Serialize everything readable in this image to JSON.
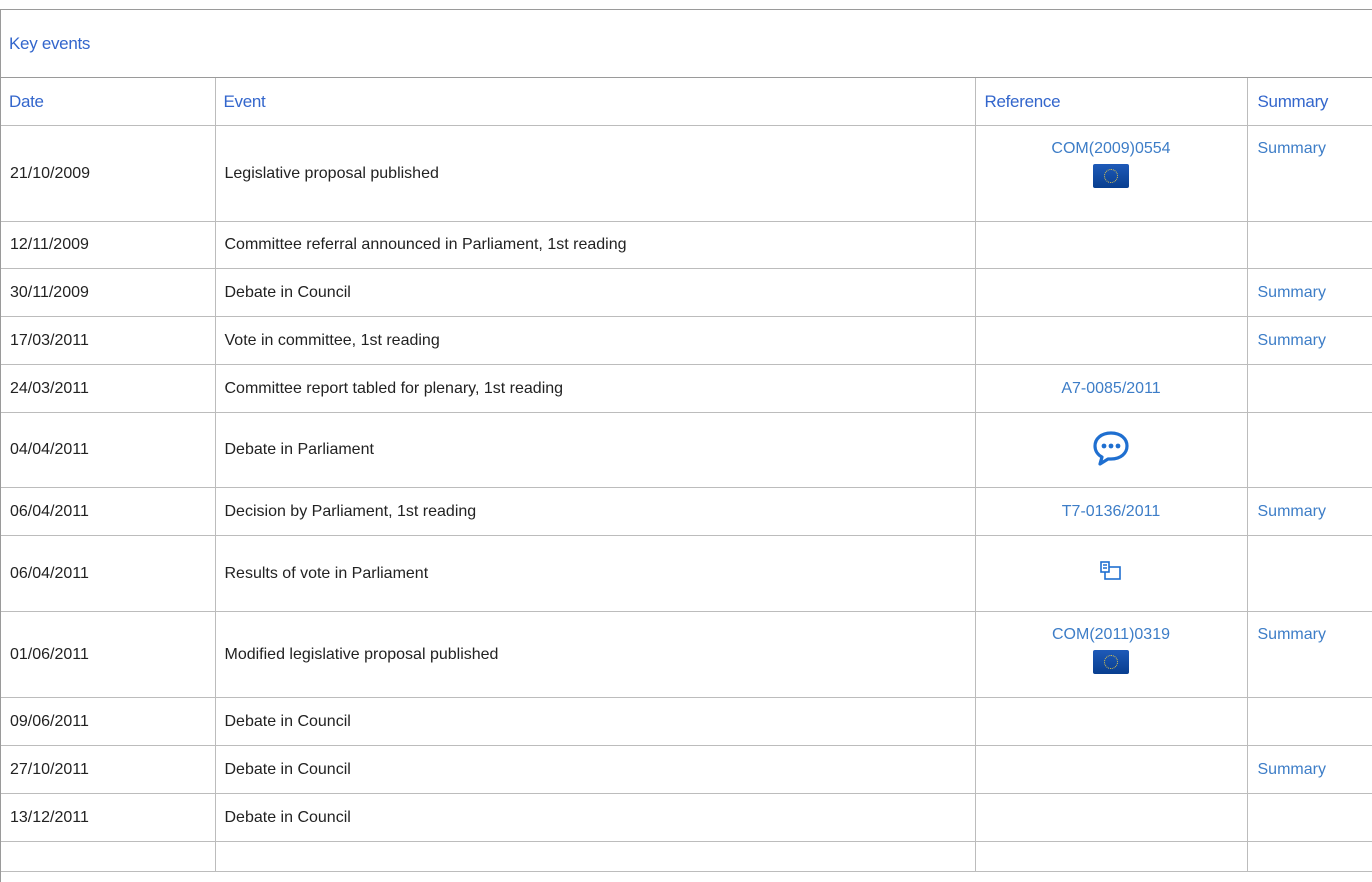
{
  "section_title": "Key events",
  "columns": {
    "date": "Date",
    "event": "Event",
    "reference": "Reference",
    "summary": "Summary"
  },
  "colors": {
    "link": "#3d7dc7",
    "header": "#3366cc",
    "eu_flag": "#1e5ab8"
  },
  "rows": [
    {
      "date": "21/10/2009",
      "event": "Legislative proposal published",
      "reference": "COM(2009)0554",
      "ref_icon": "eu-flag-icon",
      "summary": "Summary"
    },
    {
      "date": "12/11/2009",
      "event": "Committee referral announced in Parliament, 1st reading",
      "reference": "",
      "ref_icon": "",
      "summary": ""
    },
    {
      "date": "30/11/2009",
      "event": "Debate in Council",
      "reference": "",
      "ref_icon": "",
      "summary": "Summary"
    },
    {
      "date": "17/03/2011",
      "event": "Vote in committee, 1st reading",
      "reference": "",
      "ref_icon": "",
      "summary": "Summary"
    },
    {
      "date": "24/03/2011",
      "event": "Committee report tabled for plenary, 1st reading",
      "reference": "A7-0085/2011",
      "ref_icon": "",
      "summary": ""
    },
    {
      "date": "04/04/2011",
      "event": "Debate in Parliament",
      "reference": "",
      "ref_icon": "speech-bubble-icon",
      "summary": ""
    },
    {
      "date": "06/04/2011",
      "event": "Decision by Parliament, 1st reading",
      "reference": "T7-0136/2011",
      "ref_icon": "",
      "summary": "Summary"
    },
    {
      "date": "06/04/2011",
      "event": "Results of vote in Parliament",
      "reference": "",
      "ref_icon": "vote-results-icon",
      "summary": ""
    },
    {
      "date": "01/06/2011",
      "event": "Modified legislative proposal published",
      "reference": "COM(2011)0319",
      "ref_icon": "eu-flag-icon",
      "summary": "Summary"
    },
    {
      "date": "09/06/2011",
      "event": "Debate in Council",
      "reference": "",
      "ref_icon": "",
      "summary": ""
    },
    {
      "date": "27/10/2011",
      "event": "Debate in Council",
      "reference": "",
      "ref_icon": "",
      "summary": "Summary"
    },
    {
      "date": "13/12/2011",
      "event": "Debate in Council",
      "reference": "",
      "ref_icon": "",
      "summary": ""
    }
  ]
}
